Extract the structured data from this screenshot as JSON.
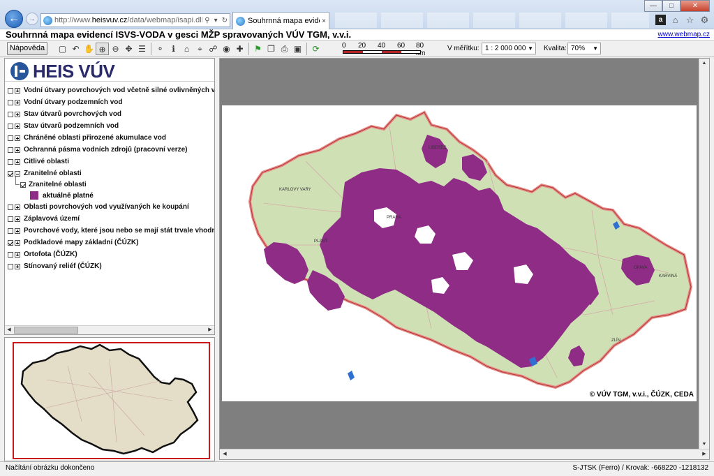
{
  "browser": {
    "url_prefix": "http://www.",
    "url_domain": "heisvuv.cz",
    "url_rest": "/data/webmap/isapi.dll?map=n",
    "tab_title": "Souhrnná mapa evidencí IS...",
    "tab_close": "×"
  },
  "app": {
    "title": "Souhrnná mapa evidencí ISVS-VODA v gesci MŽP spravovaných VÚV TGM, v.v.i.",
    "link": "www.webmap.cz"
  },
  "toolbar": {
    "help_label": "Nápověda",
    "scale_labels": [
      "0",
      "20",
      "40",
      "60",
      "80 km"
    ],
    "scale_prefix": "V měřítku:",
    "scale_value": "1 : 2 000 000",
    "quality_label": "Kvalita:",
    "quality_value": "70%"
  },
  "logo": {
    "text": "HEIS VÚV"
  },
  "layers": [
    {
      "label": "Vodní útvary povrchových vod včetně silné ovlivněných vodních útv",
      "checked": false,
      "expanded": false
    },
    {
      "label": "Vodní útvary podzemních vod",
      "checked": false,
      "expanded": false
    },
    {
      "label": "Stav útvarů povrchových vod",
      "checked": false,
      "expanded": false
    },
    {
      "label": "Stav útvarů podzemních vod",
      "checked": false,
      "expanded": false
    },
    {
      "label": "Chráněné oblasti přirozené akumulace vod",
      "checked": false,
      "expanded": false
    },
    {
      "label": "Ochranná pásma vodních zdrojů (pracovní verze)",
      "checked": false,
      "expanded": false
    },
    {
      "label": "Citlivé oblasti",
      "checked": false,
      "expanded": false
    },
    {
      "label": "Zranitelné oblasti",
      "checked": true,
      "expanded": true
    },
    {
      "label": "Oblasti povrchových vod využívaných ke koupání",
      "checked": false,
      "expanded": false
    },
    {
      "label": "Záplavová území",
      "checked": false,
      "expanded": false
    },
    {
      "label": "Povrchové vody, které jsou nebo se mají stát trvale vhodnými pro ž",
      "checked": false,
      "expanded": false
    },
    {
      "label": "Podkladové mapy základní (ČÚZK)",
      "checked": true,
      "expanded": false
    },
    {
      "label": "Ortofota (ČÚZK)",
      "checked": false,
      "expanded": false
    },
    {
      "label": "Stínovaný reliéf (ČÚZK)",
      "checked": false,
      "expanded": false
    }
  ],
  "sublayer": {
    "label": "Zranitelné oblasti",
    "checked": true,
    "legend_label": "aktuálně platné",
    "legend_color": "#8e2c86"
  },
  "map": {
    "copyright": "© VÚV TGM, v.v.i., ČÚZK, CEDA",
    "place_labels": [
      "LIBEREC",
      "KARLOVY VARY",
      "PRAHA",
      "PLZEŇ",
      "OPAVA",
      "KARVINÁ",
      "ZLÍN"
    ]
  },
  "colors": {
    "vulnerable_zone": "#8e2c86",
    "basemap": "#cfe0b4",
    "border": "#e68a8a",
    "overview_frame": "#c81a1a"
  },
  "status": {
    "left": "Načítání obrázku dokončeno",
    "right": "S-JTSK (Ferro) / Krovak: -668220 -1218132"
  }
}
